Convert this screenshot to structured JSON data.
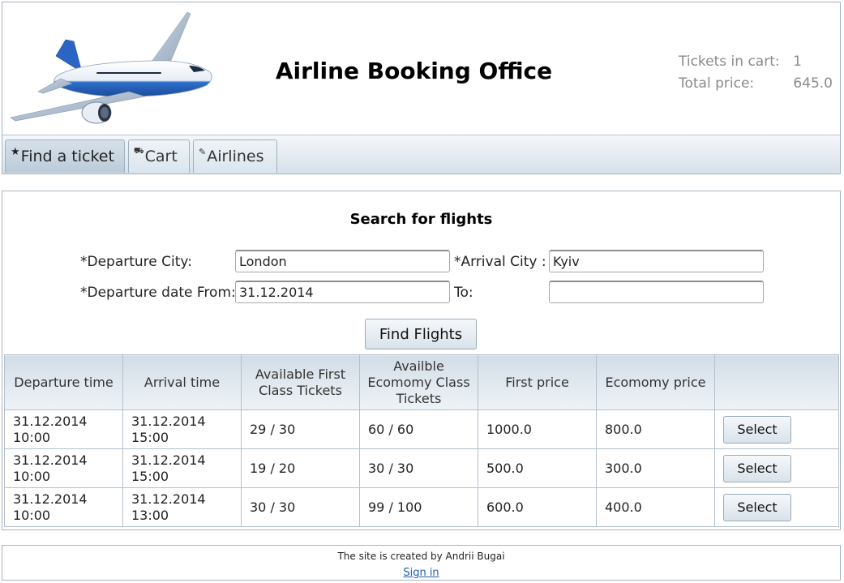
{
  "header": {
    "title": "Airline Booking Office",
    "tickets_label": "Tickets in cart:",
    "tickets_value": "1",
    "price_label": "Total price:",
    "price_value": "645.0"
  },
  "tabs": [
    {
      "label": "Find a ticket",
      "icon": "star-icon",
      "glyph": "★"
    },
    {
      "label": "Cart",
      "icon": "cart-icon",
      "glyph": "⛟"
    },
    {
      "label": "Airlines",
      "icon": "pin-icon",
      "glyph": "✎"
    }
  ],
  "search": {
    "heading": "Search for flights",
    "departure_city_label": "*Departure City:",
    "departure_city_value": "London",
    "arrival_city_label": "*Arrival City :",
    "arrival_city_value": "Kyiv",
    "date_from_label": "*Departure date From:",
    "date_from_value": "31.12.2014",
    "date_to_label": "To:",
    "date_to_value": "",
    "find_button": "Find Flights"
  },
  "table": {
    "headers": [
      "Departure time",
      "Arrival time",
      "Available First Class Tickets",
      "Availble Ecomomy Class Tickets",
      "First price",
      "Ecomomy price",
      ""
    ],
    "select_label": "Select",
    "rows": [
      {
        "departure": "31.12.2014 10:00",
        "arrival": "31.12.2014 15:00",
        "first_avail": "29 / 30",
        "econ_avail": "60 / 60",
        "first_price": "1000.0",
        "econ_price": "800.0"
      },
      {
        "departure": "31.12.2014 10:00",
        "arrival": "31.12.2014 15:00",
        "first_avail": "19 / 20",
        "econ_avail": "30 / 30",
        "first_price": "500.0",
        "econ_price": "300.0"
      },
      {
        "departure": "31.12.2014 10:00",
        "arrival": "31.12.2014 13:00",
        "first_avail": "30 / 30",
        "econ_avail": "99 / 100",
        "first_price": "600.0",
        "econ_price": "400.0"
      }
    ]
  },
  "footer": {
    "credit": "The site is created by Andrii Bugai",
    "sign_in": "Sign in"
  }
}
